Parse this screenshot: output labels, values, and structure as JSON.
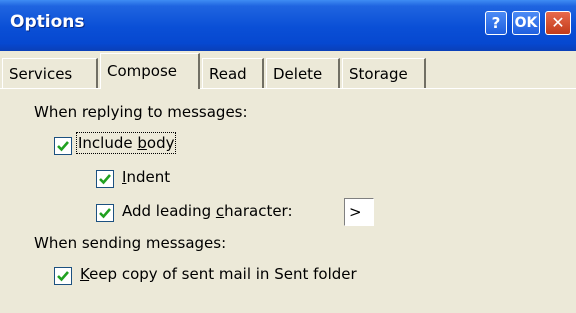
{
  "window": {
    "title": "Options",
    "help_label": "?",
    "ok_label": "OK",
    "close_label": "✕"
  },
  "tabs": [
    {
      "label": "Services",
      "active": false
    },
    {
      "label": "Compose",
      "active": true
    },
    {
      "label": "Read",
      "active": false
    },
    {
      "label": "Delete",
      "active": false
    },
    {
      "label": "Storage",
      "active": false
    }
  ],
  "compose": {
    "replying_heading": "When replying to messages:",
    "include_body": {
      "pre": "Include ",
      "ul": "b",
      "post": "ody",
      "checked": true
    },
    "indent": {
      "pre": "",
      "ul": "I",
      "post": "ndent",
      "checked": true
    },
    "leading_char": {
      "pre": "Add leading ",
      "ul": "c",
      "post": "haracter:",
      "checked": true,
      "value": ">"
    },
    "sending_heading": "When sending messages:",
    "keep_copy": {
      "pre": "",
      "ul": "K",
      "post": "eep copy of sent mail in Sent folder",
      "checked": true
    }
  },
  "colors": {
    "titlebar": "#0a4fd6",
    "check": "#21a121",
    "face": "#ece9d8"
  }
}
